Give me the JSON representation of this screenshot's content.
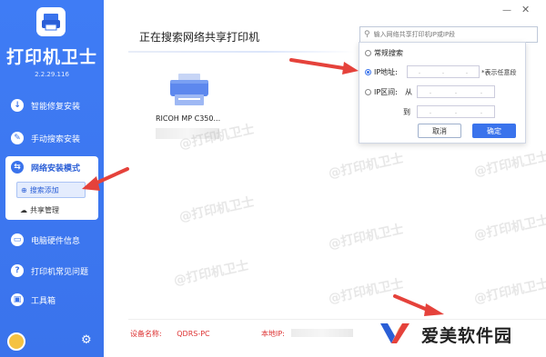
{
  "app": {
    "title": "打印机卫士",
    "version": "2.2.29.116"
  },
  "sidebar": {
    "items": [
      {
        "label": "智能修复安装",
        "icon": "download-circle-icon"
      },
      {
        "label": "手动搜索安装",
        "icon": "wrench-icon"
      },
      {
        "label": "网络安装模式",
        "icon": "network-icon"
      },
      {
        "label": "电脑硬件信息",
        "icon": "computer-icon"
      },
      {
        "label": "打印机常见问题",
        "icon": "question-icon"
      },
      {
        "label": "工具箱",
        "icon": "toolbox-icon"
      }
    ],
    "sub_items": [
      {
        "label": "搜索添加",
        "icon": "search-add-icon"
      },
      {
        "label": "共享管理",
        "icon": "cloud-icon"
      }
    ]
  },
  "main": {
    "title": "正在搜索网络共享打印机",
    "printer_name": "RICOH MP C350..."
  },
  "search": {
    "placeholder": "输入网络共享打印机IP或IP段",
    "options": {
      "normal": "常规搜索",
      "ip": "IP地址:",
      "range": "IP区间:"
    },
    "ip_hint": "*表示任意段",
    "range_from": "从",
    "range_to": "到",
    "cancel_label": "取消",
    "ok_label": "确定",
    "selected": "ip"
  },
  "footer": {
    "device_label": "设备名称:",
    "device_name": "QDRS-PC",
    "ip_label": "本地IP:"
  },
  "watermark": "@打印机卫士",
  "brand": {
    "text": "爱美软件园"
  },
  "colors": {
    "primary": "#3a73ec",
    "arrow": "#e5423b",
    "footer_text": "#d33333"
  }
}
